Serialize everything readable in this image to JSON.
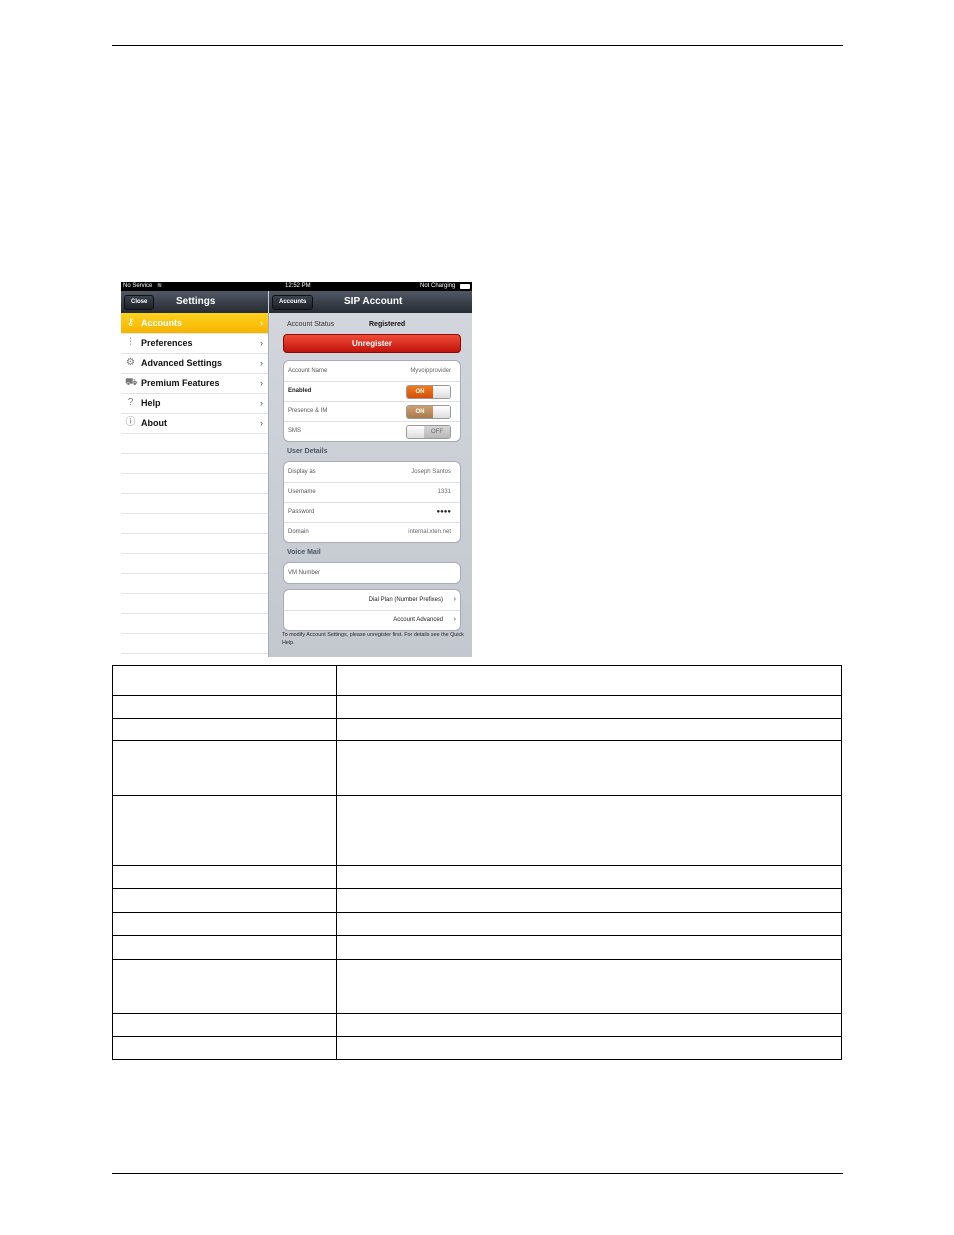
{
  "screenshot": {
    "status_bar": {
      "carrier": "No Service",
      "time": "12:52 PM",
      "battery": "Not Charging"
    },
    "left_nav": {
      "close_button": "Close",
      "title": "Settings"
    },
    "right_nav": {
      "back_button": "Accounts",
      "title": "SIP Account"
    },
    "sidebar": [
      {
        "label": "Accounts",
        "icon": "key-icon",
        "selected": true
      },
      {
        "label": "Preferences",
        "icon": "sliders-icon",
        "selected": false
      },
      {
        "label": "Advanced Settings",
        "icon": "gears-icon",
        "selected": false
      },
      {
        "label": "Premium Features",
        "icon": "cart-icon",
        "selected": false
      },
      {
        "label": "Help",
        "icon": "question-icon",
        "selected": false
      },
      {
        "label": "About",
        "icon": "info-icon",
        "selected": false
      }
    ],
    "account_status_label": "Account Status",
    "account_status_value": "Registered",
    "unregister_button": "Unregister",
    "account_group": {
      "account_name_label": "Account Name",
      "account_name_value": "Myvoipprovider",
      "enabled_label": "Enabled",
      "enabled_state": "ON",
      "presence_label": "Presence & IM",
      "presence_state": "ON",
      "sms_label": "SMS",
      "sms_state": "OFF"
    },
    "user_details_header": "User Details",
    "user_details": {
      "display_label": "Display as",
      "display_value": "Joseph Santos",
      "username_label": "Username",
      "username_value": "1331",
      "password_label": "Password",
      "password_value": "●●●●",
      "domain_label": "Domain",
      "domain_value": "internal.xten.net"
    },
    "voice_mail_header": "Voice Mail",
    "vm_number_label": "VM Number",
    "dial_plan_link": "Dial Plan (Number Prefixes)",
    "account_advanced_link": "Account Advanced",
    "footer_note": "To modify Account Settings, please unregister first. For details see the Quick Help."
  },
  "table": {
    "rows": [
      [
        "",
        ""
      ],
      [
        "",
        ""
      ],
      [
        "",
        ""
      ],
      [
        "",
        ""
      ],
      [
        "",
        ""
      ],
      [
        "",
        ""
      ],
      [
        "",
        ""
      ],
      [
        "",
        ""
      ],
      [
        "",
        ""
      ],
      [
        "",
        ""
      ],
      [
        "",
        ""
      ],
      [
        "",
        ""
      ]
    ]
  },
  "colors": {
    "selected_row": "#f5b400",
    "unregister": "#d4200f",
    "toggle_on": "#e8600a",
    "nav_bar": "#2f353e"
  }
}
